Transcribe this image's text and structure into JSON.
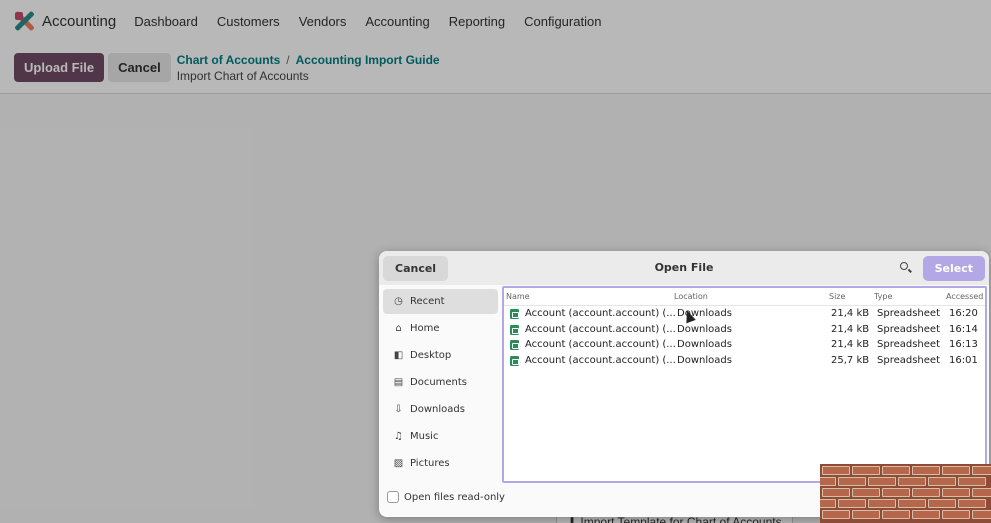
{
  "navbar": {
    "app_name": "Accounting",
    "menu": [
      "Dashboard",
      "Customers",
      "Vendors",
      "Accounting",
      "Reporting",
      "Configuration"
    ]
  },
  "control_bar": {
    "upload_label": "Upload File",
    "cancel_label": "Cancel",
    "breadcrumb": [
      "Chart of Accounts",
      "Accounting Import Guide"
    ],
    "breadcrumb_separator": "/",
    "current_page": "Import Chart of Accounts"
  },
  "background_button_label": "⬇ Import Template for Chart of Accounts",
  "dialog": {
    "title": "Open File",
    "cancel_label": "Cancel",
    "select_label": "Select",
    "places": [
      {
        "label": "Recent",
        "icon": "clock-icon"
      },
      {
        "label": "Home",
        "icon": "home-icon"
      },
      {
        "label": "Desktop",
        "icon": "desktop-icon"
      },
      {
        "label": "Documents",
        "icon": "document-icon"
      },
      {
        "label": "Downloads",
        "icon": "download-icon"
      },
      {
        "label": "Music",
        "icon": "music-icon"
      },
      {
        "label": "Pictures",
        "icon": "picture-icon"
      }
    ],
    "readonly_label": "Open files read-only",
    "columns": {
      "name": "Name",
      "location": "Location",
      "size": "Size",
      "type": "Type",
      "accessed": "Accessed"
    },
    "files": [
      {
        "name": "Account (account.account) (...",
        "location": "Downloads",
        "size": "21,4 kB",
        "type": "Spreadsheet",
        "accessed": "16:20"
      },
      {
        "name": "Account (account.account) (...",
        "location": "Downloads",
        "size": "21,4 kB",
        "type": "Spreadsheet",
        "accessed": "16:14"
      },
      {
        "name": "Account (account.account) (...",
        "location": "Downloads",
        "size": "21,4 kB",
        "type": "Spreadsheet",
        "accessed": "16:13"
      },
      {
        "name": "Account (account.account) (...",
        "location": "Downloads",
        "size": "25,7 kB",
        "type": "Spreadsheet",
        "accessed": "16:01"
      }
    ]
  },
  "colors": {
    "brand": "#714b67",
    "link": "#017e84",
    "select_accent": "#b3a7e6",
    "sheet_icon": "#2c8c55"
  }
}
